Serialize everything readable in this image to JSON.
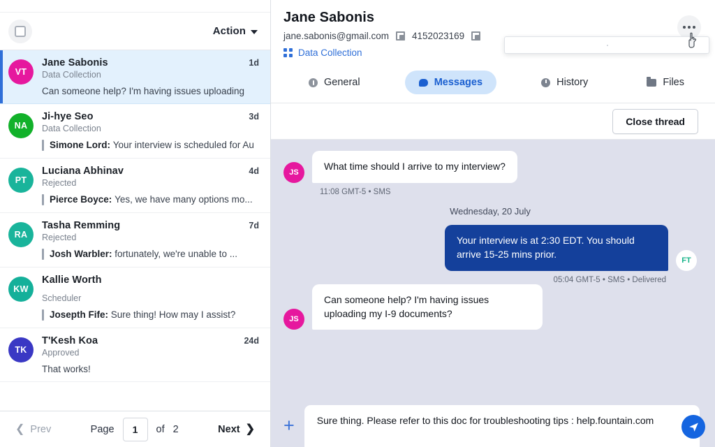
{
  "sidebar": {
    "toolbar": {
      "checkbox_label": "select-all",
      "action_label": "Action"
    },
    "threads": [
      {
        "initials": "VT",
        "color": "#e6189e",
        "name": "Jane Sabonis",
        "stage": "Data Collection",
        "time": "1d",
        "preview_sender": "",
        "preview": "Can someone help? I'm having issues uploading",
        "selected": true
      },
      {
        "initials": "NA",
        "color": "#12b12a",
        "name": "Ji-hye Seo",
        "stage": "Data Collection",
        "time": "3d",
        "preview_sender": "Simone Lord:",
        "preview": "Your interview is scheduled for Au",
        "selected": false
      },
      {
        "initials": "PT",
        "color": "#19b49b",
        "name": "Luciana Abhinav",
        "stage": "Rejected",
        "time": "4d",
        "preview_sender": "Pierce Boyce:",
        "preview": "Yes, we have many options mo...",
        "selected": false
      },
      {
        "initials": "RA",
        "color": "#19b49b",
        "name": "Tasha Remming",
        "stage": "Rejected",
        "time": "7d",
        "preview_sender": "Josh Warbler:",
        "preview": "fortunately, we're unable to ...",
        "selected": false
      },
      {
        "initials": "KW",
        "color": "#14b09a",
        "name": "Kallie Worth",
        "stage": "Scheduler",
        "time": "",
        "preview_sender": "Josepth Fife:",
        "preview": "Sure thing! How may I assist?",
        "selected": false
      },
      {
        "initials": "TK",
        "color": "#3a38c4",
        "name": "T'Kesh Koa",
        "stage": "Approved",
        "time": "24d",
        "preview_sender": "",
        "preview": "That works!",
        "selected": false
      }
    ],
    "pagination": {
      "prev": "Prev",
      "page_label": "Page",
      "current": "1",
      "of": "of",
      "total": "2",
      "next": "Next"
    }
  },
  "detail": {
    "name": "Jane Sabonis",
    "email": "jane.sabonis@gmail.com",
    "phone": "4152023169",
    "tag": "Data Collection",
    "tabs": [
      {
        "label": "General",
        "icon": "info-icon",
        "active": false
      },
      {
        "label": "Messages",
        "icon": "message-bubble-icon",
        "active": true
      },
      {
        "label": "History",
        "icon": "clock-icon",
        "active": false
      },
      {
        "label": "Files",
        "icon": "folder-icon",
        "active": false
      }
    ],
    "close_thread_label": "Close thread"
  },
  "conversation": {
    "messages": [
      {
        "dir": "in",
        "initials": "JS",
        "color": "#e6189e",
        "text": "What time should I arrive to my interview?",
        "stamp": "11:08 GMT-5  •  SMS"
      },
      {
        "dir": "day",
        "text": "Wednesday, 20 July"
      },
      {
        "dir": "out",
        "initials": "FT",
        "color": "#ffffff",
        "text": "Your interview is at 2:30 EDT. You should arrive 15-25 mins prior.",
        "stamp": "05:04 GMT-5  •  SMS  •  Delivered"
      },
      {
        "dir": "in",
        "initials": "JS",
        "color": "#e6189e",
        "text": "Can someone help? I'm having issues uploading my I-9 documents?",
        "stamp": ""
      }
    ],
    "composer": {
      "value": "Sure thing. Please refer to this doc for troubleshooting tips : help.fountain.com",
      "add_label": "+",
      "send_label": "send"
    }
  }
}
